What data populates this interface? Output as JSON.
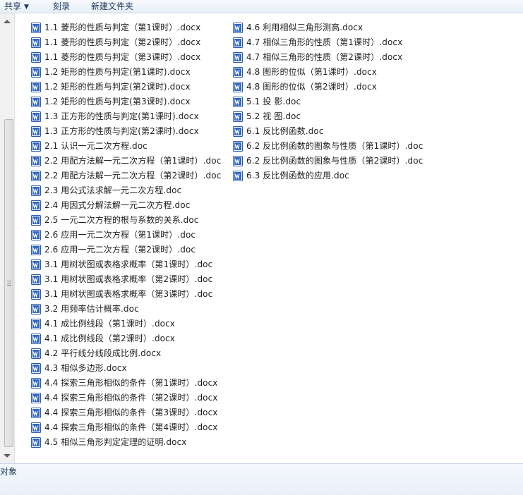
{
  "toolbar": {
    "share_label": "共享",
    "burn_label": "刻录",
    "new_folder_label": "新建文件夹"
  },
  "status": {
    "text": "对象"
  },
  "icons": {
    "file": "word-doc-icon",
    "accent": "#2b5aa5"
  },
  "files": {
    "col1": [
      "1.1  菱形的性质与判定（第1课时）.docx",
      "1.1  菱形的性质与判定（第2课时）.docx",
      "1.1  菱形的性质与判定（第3课时）.docx",
      "1.2  矩形的性质与判定(第1课时).docx",
      "1.2  矩形的性质与判定(第2课时).docx",
      "1.2  矩形的性质与判定(第3课时).docx",
      "1.3  正方形的性质与判定(第1课时).docx",
      "1.3  正方形的性质与判定(第2课时).docx",
      "2.1  认识一元二次方程.doc",
      "2.2  用配方法解一元二次方程（第1课时）.doc",
      "2.2  用配方法解一元二次方程（第2课时）.doc",
      "2.3  用公式法求解一元二次方程.doc",
      "2.4  用因式分解法解一元二次方程.doc",
      "2.5  一元二次方程的根与系数的关系.doc",
      "2.6  应用一元二次方程（第1课时）.doc",
      "2.6  应用一元二次方程（第2课时）.doc",
      "3.1  用树状图或表格求概率（第1课时）.doc",
      "3.1  用树状图或表格求概率（第2课时）.doc",
      "3.1  用树状图或表格求概率（第3课时）.doc",
      "3.2  用频率估计概率.doc",
      "4.1  成比例线段（第1课时）.docx",
      "4.1  成比例线段（第2课时）.docx",
      "4.2  平行线分线段成比例.docx",
      "4.3  相似多边形.docx",
      "4.4  探索三角形相似的条件（第1课时）.docx",
      "4.4  探索三角形相似的条件（第2课时）.docx",
      "4.4  探索三角形相似的条件（第3课时）.docx",
      "4.4  探索三角形相似的条件（第4课时）.docx",
      "4.5  相似三角形判定定理的证明.docx"
    ],
    "col2": [
      "4.6  利用相似三角形测高.docx",
      "4.7  相似三角形的性质（第1课时）.docx",
      "4.7  相似三角形的性质（第2课时）.docx",
      "4.8  图形的位似（第1课时）.docx",
      "4.8  图形的位似（第2课时）.docx",
      "5.1  投  影.doc",
      "5.2  视  图.doc",
      "6.1  反比例函数.doc",
      "6.2  反比例函数的图象与性质（第1课时）.doc",
      "6.2  反比例函数的图象与性质（第2课时）.doc",
      "6.3  反比例函数的应用.doc"
    ]
  }
}
